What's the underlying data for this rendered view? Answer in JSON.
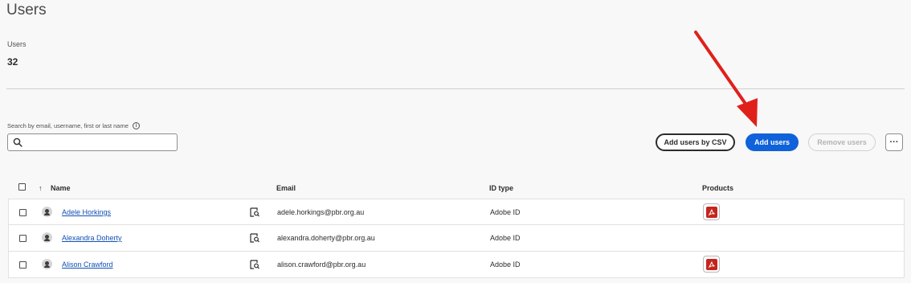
{
  "page": {
    "title": "Users"
  },
  "stats": {
    "label": "Users",
    "value": "32"
  },
  "search": {
    "label": "Search by email, username, first or last name",
    "value": ""
  },
  "actions": {
    "add_csv": "Add users by CSV",
    "add_users": "Add users",
    "remove_users": "Remove users",
    "more": "···"
  },
  "table": {
    "headers": {
      "name": "Name",
      "email": "Email",
      "id_type": "ID type",
      "products": "Products"
    },
    "sort_indicator": "↑",
    "rows": [
      {
        "name": "Adele Horkings",
        "email": "adele.horkings@pbr.org.au",
        "id_type": "Adobe ID",
        "products": [
          "acrobat-pdf-icon"
        ]
      },
      {
        "name": "Alexandra Doherty",
        "email": "alexandra.doherty@pbr.org.au",
        "id_type": "Adobe ID",
        "products": []
      },
      {
        "name": "Alison Crawford",
        "email": "alison.crawford@pbr.org.au",
        "id_type": "Adobe ID",
        "products": [
          "acrobat-pdf-icon"
        ]
      }
    ]
  },
  "colors": {
    "primary": "#0f62d9",
    "link": "#1250b5",
    "acrobat": "#c4261d",
    "annotation_arrow": "#e0201b"
  }
}
